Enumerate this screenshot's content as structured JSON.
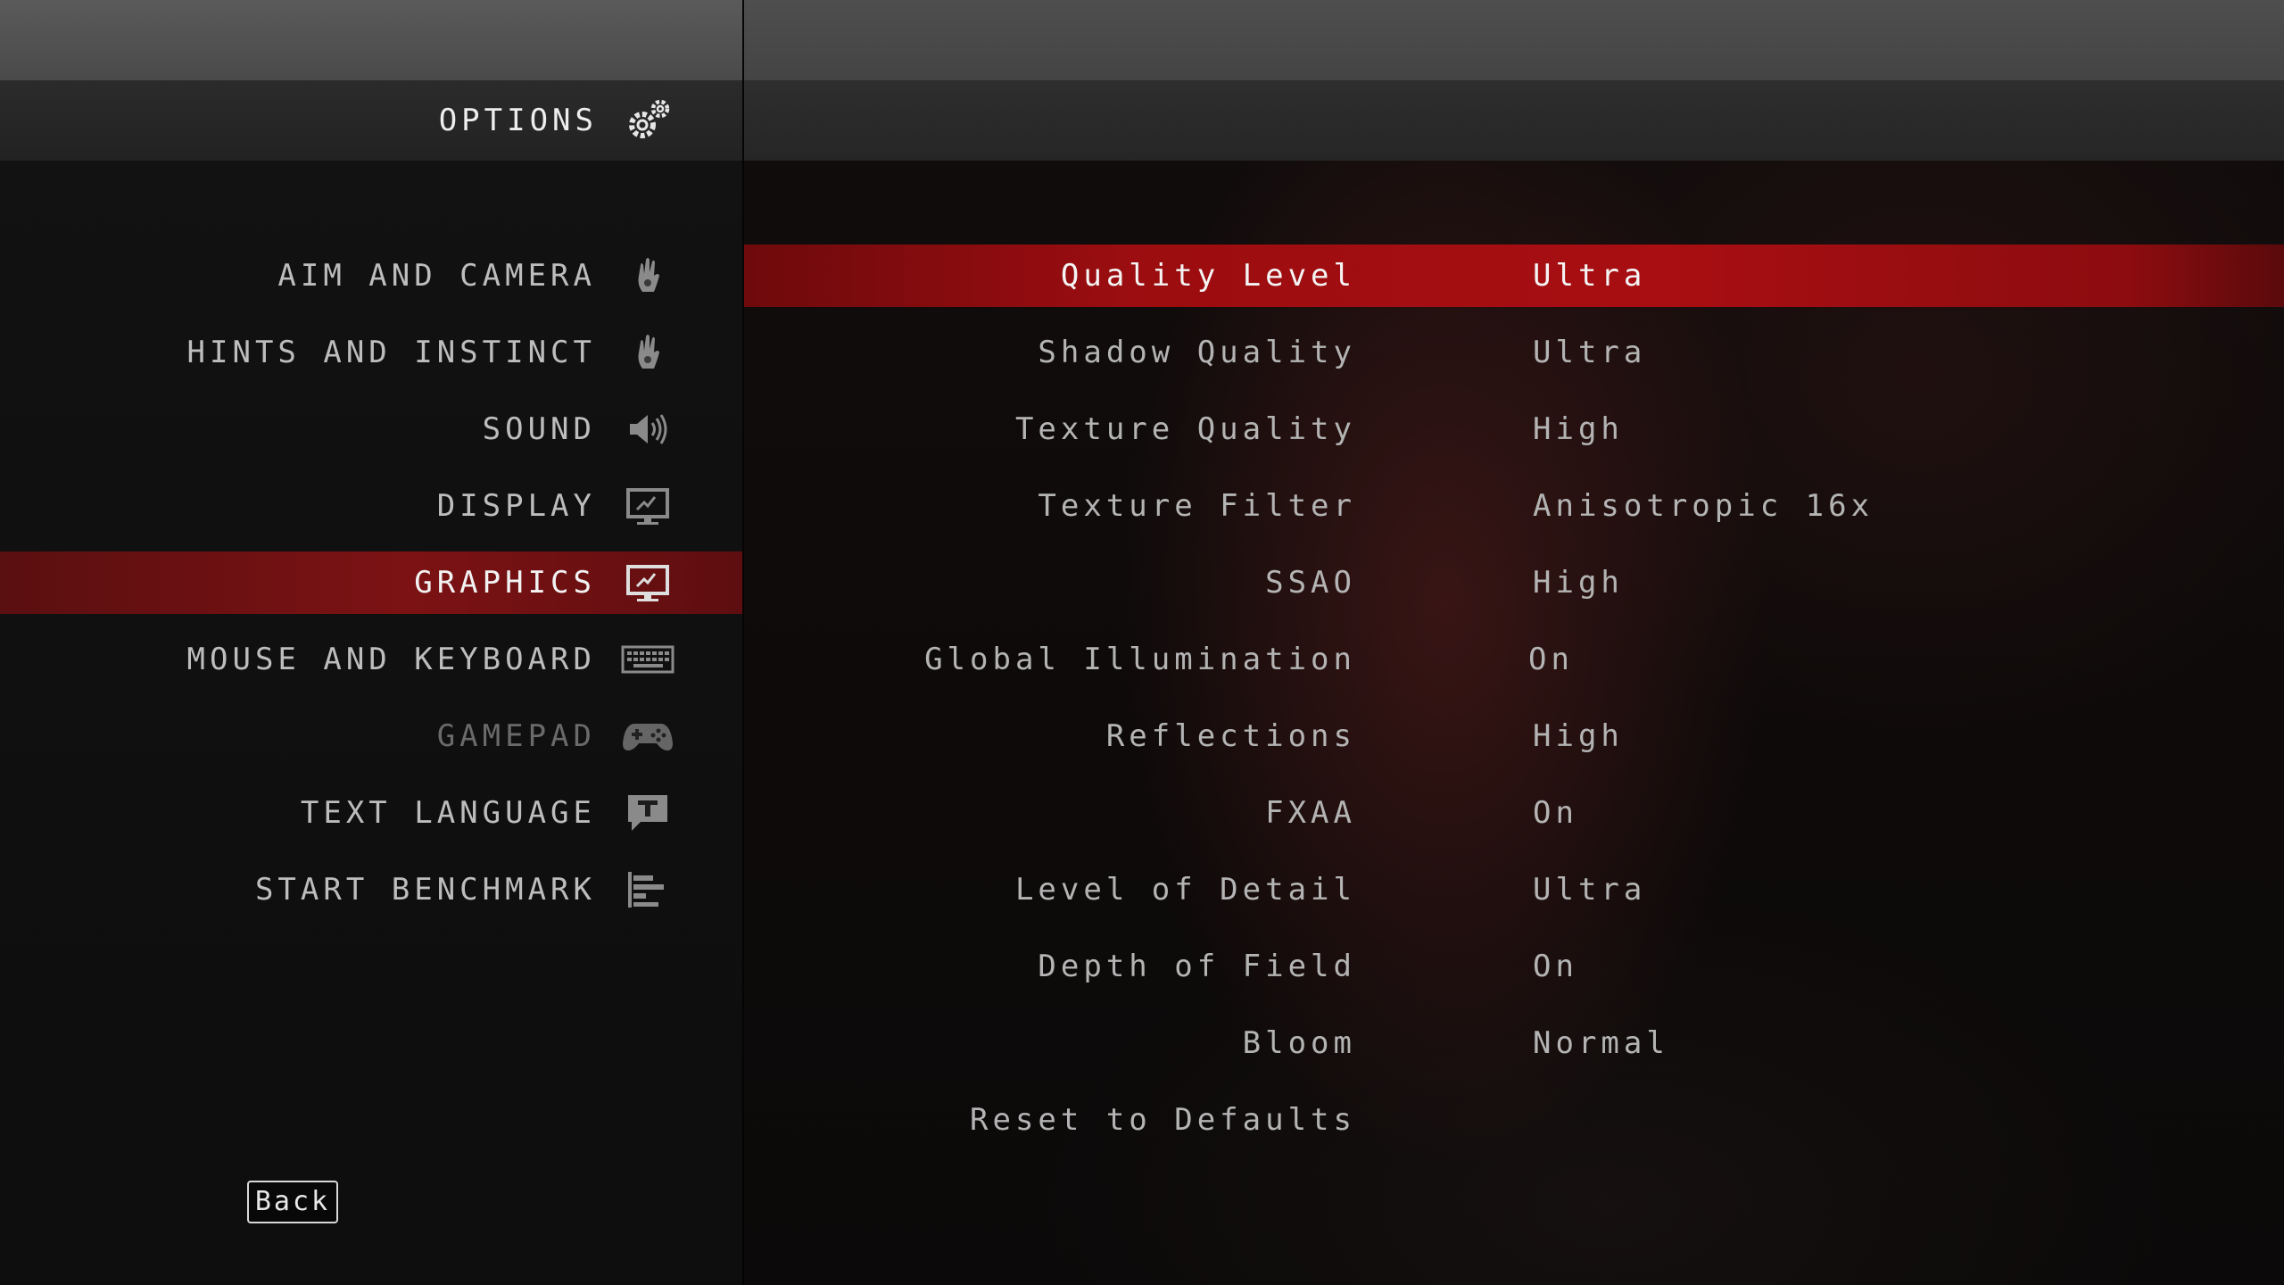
{
  "header": {
    "title": "OPTIONS",
    "icon": "gears-icon"
  },
  "menu": {
    "items": [
      {
        "label": "AIM AND CAMERA",
        "icon": "hand-icon",
        "state": "normal"
      },
      {
        "label": "HINTS AND INSTINCT",
        "icon": "hand-icon",
        "state": "normal"
      },
      {
        "label": "SOUND",
        "icon": "speaker-icon",
        "state": "normal"
      },
      {
        "label": "DISPLAY",
        "icon": "monitor-icon",
        "state": "normal"
      },
      {
        "label": "GRAPHICS",
        "icon": "monitor-icon",
        "state": "selected"
      },
      {
        "label": "MOUSE AND KEYBOARD",
        "icon": "keyboard-icon",
        "state": "normal"
      },
      {
        "label": "GAMEPAD",
        "icon": "gamepad-icon",
        "state": "disabled"
      },
      {
        "label": "TEXT LANGUAGE",
        "icon": "text-language-icon",
        "state": "normal"
      },
      {
        "label": "START BENCHMARK",
        "icon": "benchmark-icon",
        "state": "normal"
      }
    ]
  },
  "settings": {
    "rows": [
      {
        "label": "Quality Level",
        "value": "Ultra",
        "selected": true
      },
      {
        "label": "Shadow Quality",
        "value": "Ultra"
      },
      {
        "label": "Texture Quality",
        "value": "High"
      },
      {
        "label": "Texture Filter",
        "value": "Anisotropic 16x"
      },
      {
        "label": "SSAO",
        "value": "High"
      },
      {
        "label": "Global Illumination",
        "value": "On"
      },
      {
        "label": "Reflections",
        "value": "High"
      },
      {
        "label": "FXAA",
        "value": "On"
      },
      {
        "label": "Level of Detail",
        "value": "Ultra"
      },
      {
        "label": "Depth of Field",
        "value": "On"
      },
      {
        "label": "Bloom",
        "value": "Normal"
      },
      {
        "label": "Reset to Defaults",
        "value": ""
      }
    ]
  },
  "footer": {
    "back_label": "Back"
  },
  "colors": {
    "accent_red": "#a80e12",
    "selected_menu_red": "#7c1214",
    "text": "#b4b4b4",
    "text_selected": "#f4f4f4",
    "text_disabled": "#6a6a6a"
  }
}
